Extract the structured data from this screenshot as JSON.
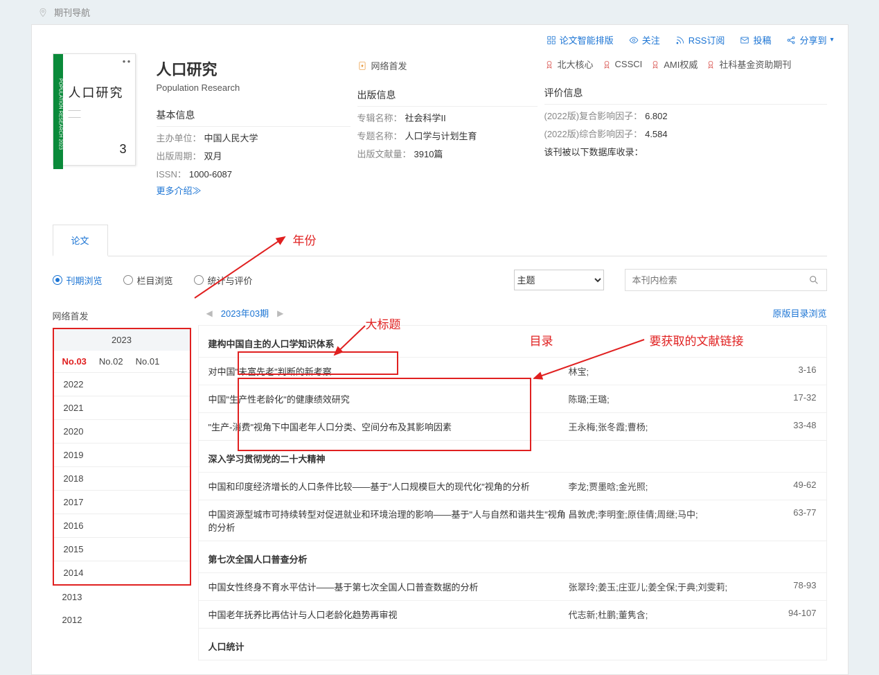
{
  "breadcrumb": "期刊导航",
  "toolbar": {
    "smart": "论文智能排版",
    "follow": "关注",
    "rss": "RSS订阅",
    "submit": "投稿",
    "share": "分享到"
  },
  "journal": {
    "title_zh": "人口研究",
    "title_en": "Population Research",
    "cover_num": "3",
    "net_first_label": "网络首发"
  },
  "badges": [
    "北大核心",
    "CSSCI",
    "AMI权威",
    "社科基金资助期刊"
  ],
  "basic": {
    "heading": "基本信息",
    "host_k": "主办单位：",
    "host_v": "中国人民大学",
    "cycle_k": "出版周期：",
    "cycle_v": "双月",
    "issn_k": "ISSN：",
    "issn_v": "1000-6087",
    "more": "更多介绍≫"
  },
  "publish": {
    "heading": "出版信息",
    "album_k": "专辑名称：",
    "album_v": "社会科学II",
    "topic_k": "专题名称：",
    "topic_v": "人口学与计划生育",
    "count_k": "出版文献量：",
    "count_v": "3910篇"
  },
  "eval": {
    "heading": "评价信息",
    "if1_k": "(2022版)复合影响因子：",
    "if1_v": "6.802",
    "if2_k": "(2022版)综合影响因子：",
    "if2_v": "4.584",
    "db": "该刊被以下数据库收录："
  },
  "tab": "论文",
  "radios": [
    "刊期浏览",
    "栏目浏览",
    "统计与评价"
  ],
  "select_topic": "主题",
  "search_placeholder": "本刊内检索",
  "net_first_side": "网络首发",
  "cur_year": "2023",
  "issues": [
    "No.03",
    "No.02",
    "No.01"
  ],
  "years_boxed": [
    "2022",
    "2021",
    "2020",
    "2019",
    "2018",
    "2017",
    "2016",
    "2015",
    "2014"
  ],
  "years_extra": [
    "2013",
    "2012"
  ],
  "issue_label": "2023年03期",
  "orig_toc": "原版目录浏览",
  "sections": [
    {
      "name": "建构中国自主的人口学知识体系",
      "articles": [
        {
          "t": "对中国\"未富先老\"判断的新考察",
          "a": "林宝;",
          "p": "3-16"
        },
        {
          "t": "中国\"生产性老龄化\"的健康绩效研究",
          "a": "陈璐;王璐;",
          "p": "17-32"
        },
        {
          "t": "\"生产-消费\"视角下中国老年人口分类、空间分布及其影响因素",
          "a": "王永梅;张冬霞;曹杨;",
          "p": "33-48"
        }
      ]
    },
    {
      "name": "深入学习贯彻党的二十大精神",
      "articles": [
        {
          "t": "中国和印度经济增长的人口条件比较——基于\"人口规模巨大的现代化\"视角的分析",
          "a": "李龙;贾墨晗;金光照;",
          "p": "49-62"
        },
        {
          "t": "中国资源型城市可持续转型对促进就业和环境治理的影响——基于\"人与自然和谐共生\"视角的分析",
          "a": "昌敦虎;李明奎;原佳倩;周继;马中;",
          "p": "63-77"
        }
      ]
    },
    {
      "name": "第七次全国人口普查分析",
      "articles": [
        {
          "t": "中国女性终身不育水平估计——基于第七次全国人口普查数据的分析",
          "a": "张翠玲;姜玉;庄亚儿;姜全保;于典;刘雯莉;",
          "p": "78-93"
        },
        {
          "t": "中国老年抚养比再估计与人口老龄化趋势再审视",
          "a": "代志新;杜鹏;董隽含;",
          "p": "94-107"
        }
      ]
    },
    {
      "name": "人口统计",
      "articles": []
    }
  ],
  "anno": {
    "year": "年份",
    "big": "大标题",
    "toc": "目录",
    "link": "要获取的文献链接"
  }
}
